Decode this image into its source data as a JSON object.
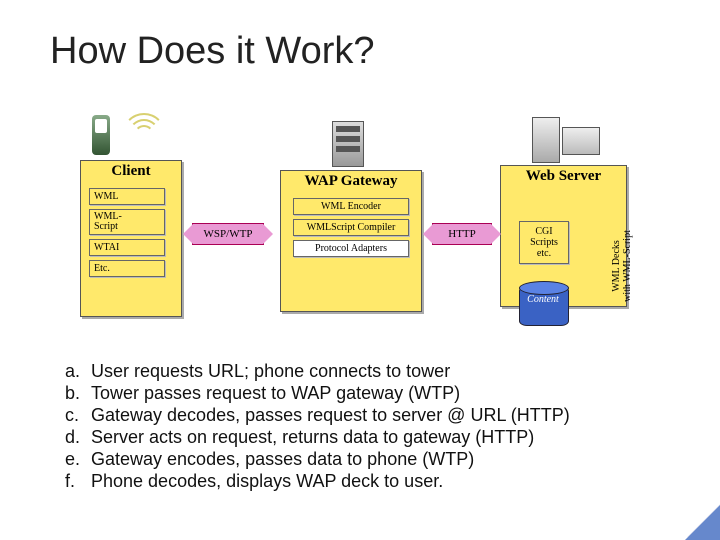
{
  "title": "How Does it Work?",
  "diagram": {
    "client": {
      "title": "Client",
      "items": [
        "WML",
        "WML-\nScript",
        "WTAI",
        "Etc."
      ]
    },
    "gateway": {
      "title": "WAP Gateway",
      "items": [
        "WML Encoder",
        "WMLScript Compiler",
        "Protocol Adapters"
      ]
    },
    "server": {
      "title": "Web Server",
      "cgi": "CGI\nScripts\netc.",
      "content": "Content",
      "side": "WML Decks\nwith WML-Script"
    },
    "arrows": {
      "left": "WSP/WTP",
      "right": "HTTP"
    }
  },
  "steps": [
    {
      "letter": "a.",
      "text": "User requests URL; phone connects to tower"
    },
    {
      "letter": "b.",
      "text": "Tower passes request to WAP gateway (WTP)"
    },
    {
      "letter": "c.",
      "text": "Gateway decodes, passes request to server @ URL (HTTP)"
    },
    {
      "letter": "d.",
      "text": "Server acts on request, returns data to gateway (HTTP)"
    },
    {
      "letter": "e.",
      "text": "Gateway encodes, passes data to phone (WTP)"
    },
    {
      "letter": "f.",
      "text": "Phone decodes, displays WAP deck to user."
    }
  ]
}
